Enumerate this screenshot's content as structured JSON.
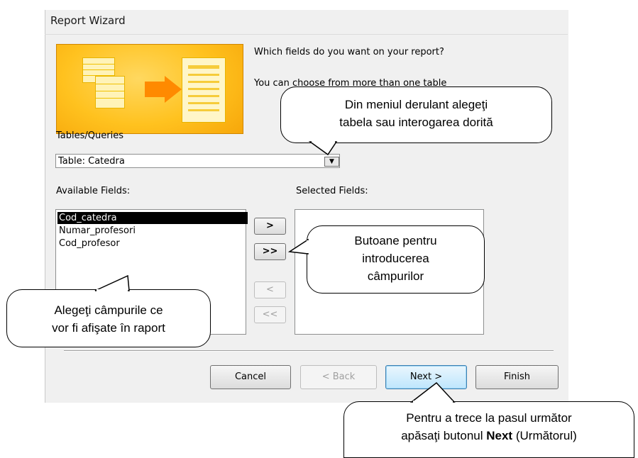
{
  "window": {
    "title": "Report Wizard"
  },
  "header": {
    "question": "Which fields do you want on your report?",
    "hint": "You can choose from more than one table"
  },
  "tables_queries": {
    "label": "Tables/Queries",
    "value": "Table: Catedra"
  },
  "available_fields": {
    "label": "Available Fields:",
    "items": [
      "Cod_catedra",
      "Numar_profesori",
      "Cod_profesor"
    ]
  },
  "selected_fields": {
    "label": "Selected Fields:",
    "items": []
  },
  "move_buttons": {
    "add_one": ">",
    "add_all": ">>",
    "remove_one": "<",
    "remove_all": "<<"
  },
  "footer": {
    "cancel": "Cancel",
    "back": "< Back",
    "next": "Next >",
    "finish": "Finish"
  },
  "callouts": {
    "dropdown": [
      "Din meniul derulant alegeţi",
      "tabela  sau interogarea dorită"
    ],
    "buttons": [
      "Butoane pentru",
      "introducerea",
      "câmpurilor"
    ],
    "fields": [
      "Alegeţi câmpurile ce",
      "vor fi afişate în raport"
    ],
    "next_prefix": "Pentru a trece la pasul următor",
    "next_action": "apăsaţi butonul",
    "next_bold": "Next",
    "next_suffix": "(Următorul)"
  }
}
